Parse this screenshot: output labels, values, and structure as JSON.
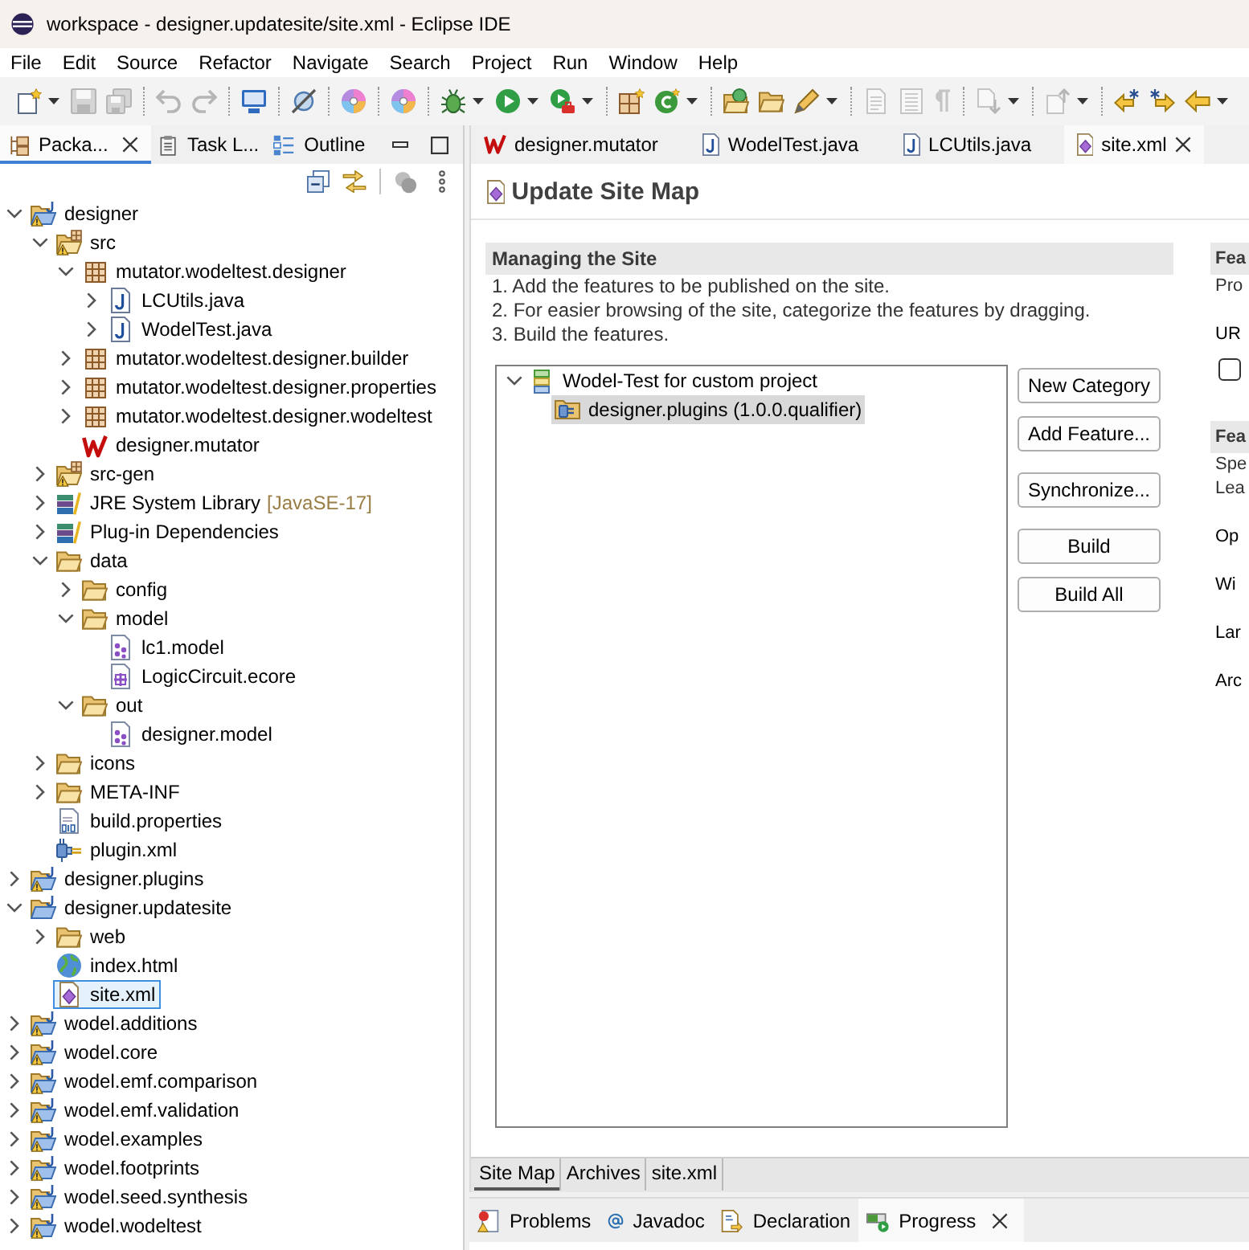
{
  "window": {
    "title": "workspace - designer.updatesite/site.xml - Eclipse IDE"
  },
  "menu": [
    "File",
    "Edit",
    "Source",
    "Refactor",
    "Navigate",
    "Search",
    "Project",
    "Run",
    "Window",
    "Help"
  ],
  "toolbar": [
    [
      {
        "kind": "new",
        "dropdown": true,
        "disabled": false
      },
      {
        "kind": "save",
        "dropdown": false,
        "disabled": true
      },
      {
        "kind": "save_all",
        "dropdown": false,
        "disabled": true
      }
    ],
    [
      {
        "kind": "undo",
        "dropdown": false,
        "disabled": true
      },
      {
        "kind": "redo",
        "dropdown": false,
        "disabled": true
      }
    ],
    [
      {
        "kind": "terminal",
        "dropdown": false,
        "disabled": false
      }
    ],
    [
      {
        "kind": "skip",
        "dropdown": false,
        "disabled": false
      }
    ],
    [
      {
        "kind": "disc",
        "dropdown": false,
        "disabled": false
      }
    ],
    [
      {
        "kind": "disc",
        "dropdown": false,
        "disabled": false
      }
    ],
    [
      {
        "kind": "debug",
        "dropdown": true,
        "disabled": false
      },
      {
        "kind": "run",
        "dropdown": true,
        "disabled": false
      },
      {
        "kind": "external",
        "dropdown": true,
        "disabled": false
      }
    ],
    [
      {
        "kind": "new_package",
        "dropdown": false,
        "disabled": false
      },
      {
        "kind": "new_class",
        "dropdown": true,
        "disabled": false
      }
    ],
    [
      {
        "kind": "open_type",
        "dropdown": false,
        "disabled": false
      },
      {
        "kind": "open_folder",
        "dropdown": false,
        "disabled": false
      },
      {
        "kind": "pen",
        "dropdown": true,
        "disabled": false
      }
    ],
    [
      {
        "kind": "doc",
        "dropdown": false,
        "disabled": true
      },
      {
        "kind": "doc_lines",
        "dropdown": false,
        "disabled": true
      },
      {
        "kind": "pilcrow",
        "dropdown": false,
        "disabled": true
      }
    ],
    [
      {
        "kind": "next",
        "dropdown": true,
        "disabled": true
      }
    ],
    [
      {
        "kind": "prev",
        "dropdown": true,
        "disabled": true
      }
    ],
    [
      {
        "kind": "last_edit",
        "dropdown": false,
        "disabled": false
      },
      {
        "kind": "forward_edit",
        "dropdown": false,
        "disabled": false
      },
      {
        "kind": "back",
        "dropdown": true,
        "disabled": false
      }
    ]
  ],
  "explorer": {
    "tabs": [
      {
        "label": "Packa...",
        "kind": "packages",
        "selected": true
      },
      {
        "label": "Task L...",
        "kind": "tasks",
        "selected": false
      },
      {
        "label": "Outline",
        "kind": "outline",
        "selected": false
      }
    ],
    "tree": [
      {
        "label": "designer",
        "kind": "project",
        "warning": true,
        "expanded": true,
        "selected": false,
        "children": [
          {
            "label": "src",
            "kind": "source_folder",
            "warning": true,
            "expanded": true,
            "selected": false,
            "children": [
              {
                "label": "mutator.wodeltest.designer",
                "kind": "package",
                "expanded": true,
                "selected": false,
                "children": [
                  {
                    "label": "LCUtils.java",
                    "kind": "java",
                    "expanded": false,
                    "selected": false
                  },
                  {
                    "label": "WodelTest.java",
                    "kind": "java",
                    "expanded": false,
                    "selected": false
                  }
                ]
              },
              {
                "label": "mutator.wodeltest.designer.builder",
                "kind": "package",
                "expanded": false,
                "selected": false
              },
              {
                "label": "mutator.wodeltest.designer.properties",
                "kind": "package",
                "expanded": false,
                "selected": false
              },
              {
                "label": "mutator.wodeltest.designer.wodeltest",
                "kind": "package",
                "expanded": false,
                "selected": false
              },
              {
                "label": "designer.mutator",
                "kind": "wodel",
                "selected": false
              }
            ]
          },
          {
            "label": "src-gen",
            "kind": "source_folder",
            "warning": true,
            "expanded": false,
            "selected": false
          },
          {
            "label": "JRE System Library",
            "decoration": "[JavaSE-17]",
            "kind": "library",
            "expanded": false,
            "selected": false
          },
          {
            "label": "Plug-in Dependencies",
            "kind": "library",
            "expanded": false,
            "selected": false
          },
          {
            "label": "data",
            "kind": "folder",
            "expanded": true,
            "selected": false,
            "children": [
              {
                "label": "config",
                "kind": "folder",
                "expanded": false,
                "selected": false
              },
              {
                "label": "model",
                "kind": "folder",
                "expanded": true,
                "selected": false,
                "children": [
                  {
                    "label": "lc1.model",
                    "kind": "model",
                    "selected": false
                  },
                  {
                    "label": "LogicCircuit.ecore",
                    "kind": "ecore",
                    "selected": false
                  }
                ]
              },
              {
                "label": "out",
                "kind": "folder",
                "expanded": true,
                "selected": false,
                "children": [
                  {
                    "label": "designer.model",
                    "kind": "model",
                    "selected": false
                  }
                ]
              }
            ]
          },
          {
            "label": "icons",
            "kind": "folder",
            "expanded": false,
            "selected": false
          },
          {
            "label": "META-INF",
            "kind": "folder",
            "expanded": false,
            "selected": false
          },
          {
            "label": "build.properties",
            "kind": "properties",
            "selected": false
          },
          {
            "label": "plugin.xml",
            "kind": "plugin",
            "selected": false
          }
        ]
      },
      {
        "label": "designer.plugins",
        "kind": "project",
        "warning": true,
        "expanded": false,
        "selected": false
      },
      {
        "label": "designer.updatesite",
        "kind": "project",
        "warning": false,
        "expanded": true,
        "selected": false,
        "children": [
          {
            "label": "web",
            "kind": "folder",
            "expanded": false,
            "selected": false
          },
          {
            "label": "index.html",
            "kind": "html",
            "selected": false
          },
          {
            "label": "site.xml",
            "kind": "site",
            "selected": true
          }
        ]
      },
      {
        "label": "wodel.additions",
        "kind": "project",
        "warning": true,
        "expanded": false,
        "selected": false
      },
      {
        "label": "wodel.core",
        "kind": "project",
        "warning": true,
        "expanded": false,
        "selected": false
      },
      {
        "label": "wodel.emf.comparison",
        "kind": "project",
        "warning": true,
        "expanded": false,
        "selected": false
      },
      {
        "label": "wodel.emf.validation",
        "kind": "project",
        "warning": true,
        "expanded": false,
        "selected": false
      },
      {
        "label": "wodel.examples",
        "kind": "project",
        "warning": true,
        "expanded": false,
        "selected": false
      },
      {
        "label": "wodel.footprints",
        "kind": "project",
        "warning": true,
        "expanded": false,
        "selected": false
      },
      {
        "label": "wodel.seed.synthesis",
        "kind": "project",
        "warning": true,
        "expanded": false,
        "selected": false
      },
      {
        "label": "wodel.wodeltest",
        "kind": "project",
        "warning": true,
        "expanded": false,
        "selected": false
      }
    ]
  },
  "editor": {
    "tabs": [
      {
        "label": "designer.mutator",
        "kind": "wodel",
        "selected": false
      },
      {
        "label": "WodelTest.java",
        "kind": "java",
        "selected": false
      },
      {
        "label": "LCUtils.java",
        "kind": "java",
        "selected": false
      },
      {
        "label": "site.xml",
        "kind": "site",
        "selected": true
      }
    ],
    "title": "Update Site Map",
    "section": {
      "heading": "Managing the Site",
      "steps": [
        "1. Add the features to be published on the site.",
        "2. For easier browsing of the site, categorize the features by dragging.",
        "3. Build the features."
      ]
    },
    "features": [
      {
        "label": "Wodel-Test for custom project",
        "kind": "category",
        "expanded": true,
        "selected": false,
        "children": [
          {
            "label": "designer.plugins (1.0.0.qualifier)",
            "kind": "feature",
            "selected": true
          }
        ]
      }
    ],
    "button_groups": [
      [
        "New Category",
        "Add Feature..."
      ],
      [
        "Synchronize..."
      ],
      [
        "Build",
        "Build All"
      ]
    ],
    "column_2": [
      {
        "kind": "heading",
        "text": "Fea"
      },
      {
        "kind": "text",
        "text": "Pro"
      },
      {
        "kind": "label",
        "text": "UR"
      },
      {
        "kind": "checkbox",
        "checked": false
      },
      {
        "kind": "heading",
        "text": "Fea"
      },
      {
        "kind": "text",
        "text": "Spe"
      },
      {
        "kind": "text",
        "text": "Lea"
      },
      {
        "kind": "label",
        "text": "Op"
      },
      {
        "kind": "label",
        "text": "Wi"
      },
      {
        "kind": "label",
        "text": "Lar"
      },
      {
        "kind": "label",
        "text": "Arc"
      }
    ],
    "page_tabs": [
      {
        "label": "Site Map",
        "selected": true
      },
      {
        "label": "Archives",
        "selected": false
      },
      {
        "label": "site.xml",
        "selected": false
      }
    ]
  },
  "bottom_panel": {
    "tabs": [
      {
        "label": "Problems",
        "kind": "problems",
        "selected": false
      },
      {
        "label": "Javadoc",
        "kind": "javadoc",
        "selected": false
      },
      {
        "label": "Declaration",
        "kind": "declaration",
        "selected": false
      },
      {
        "label": "Progress",
        "kind": "progress",
        "selected": true
      }
    ]
  }
}
